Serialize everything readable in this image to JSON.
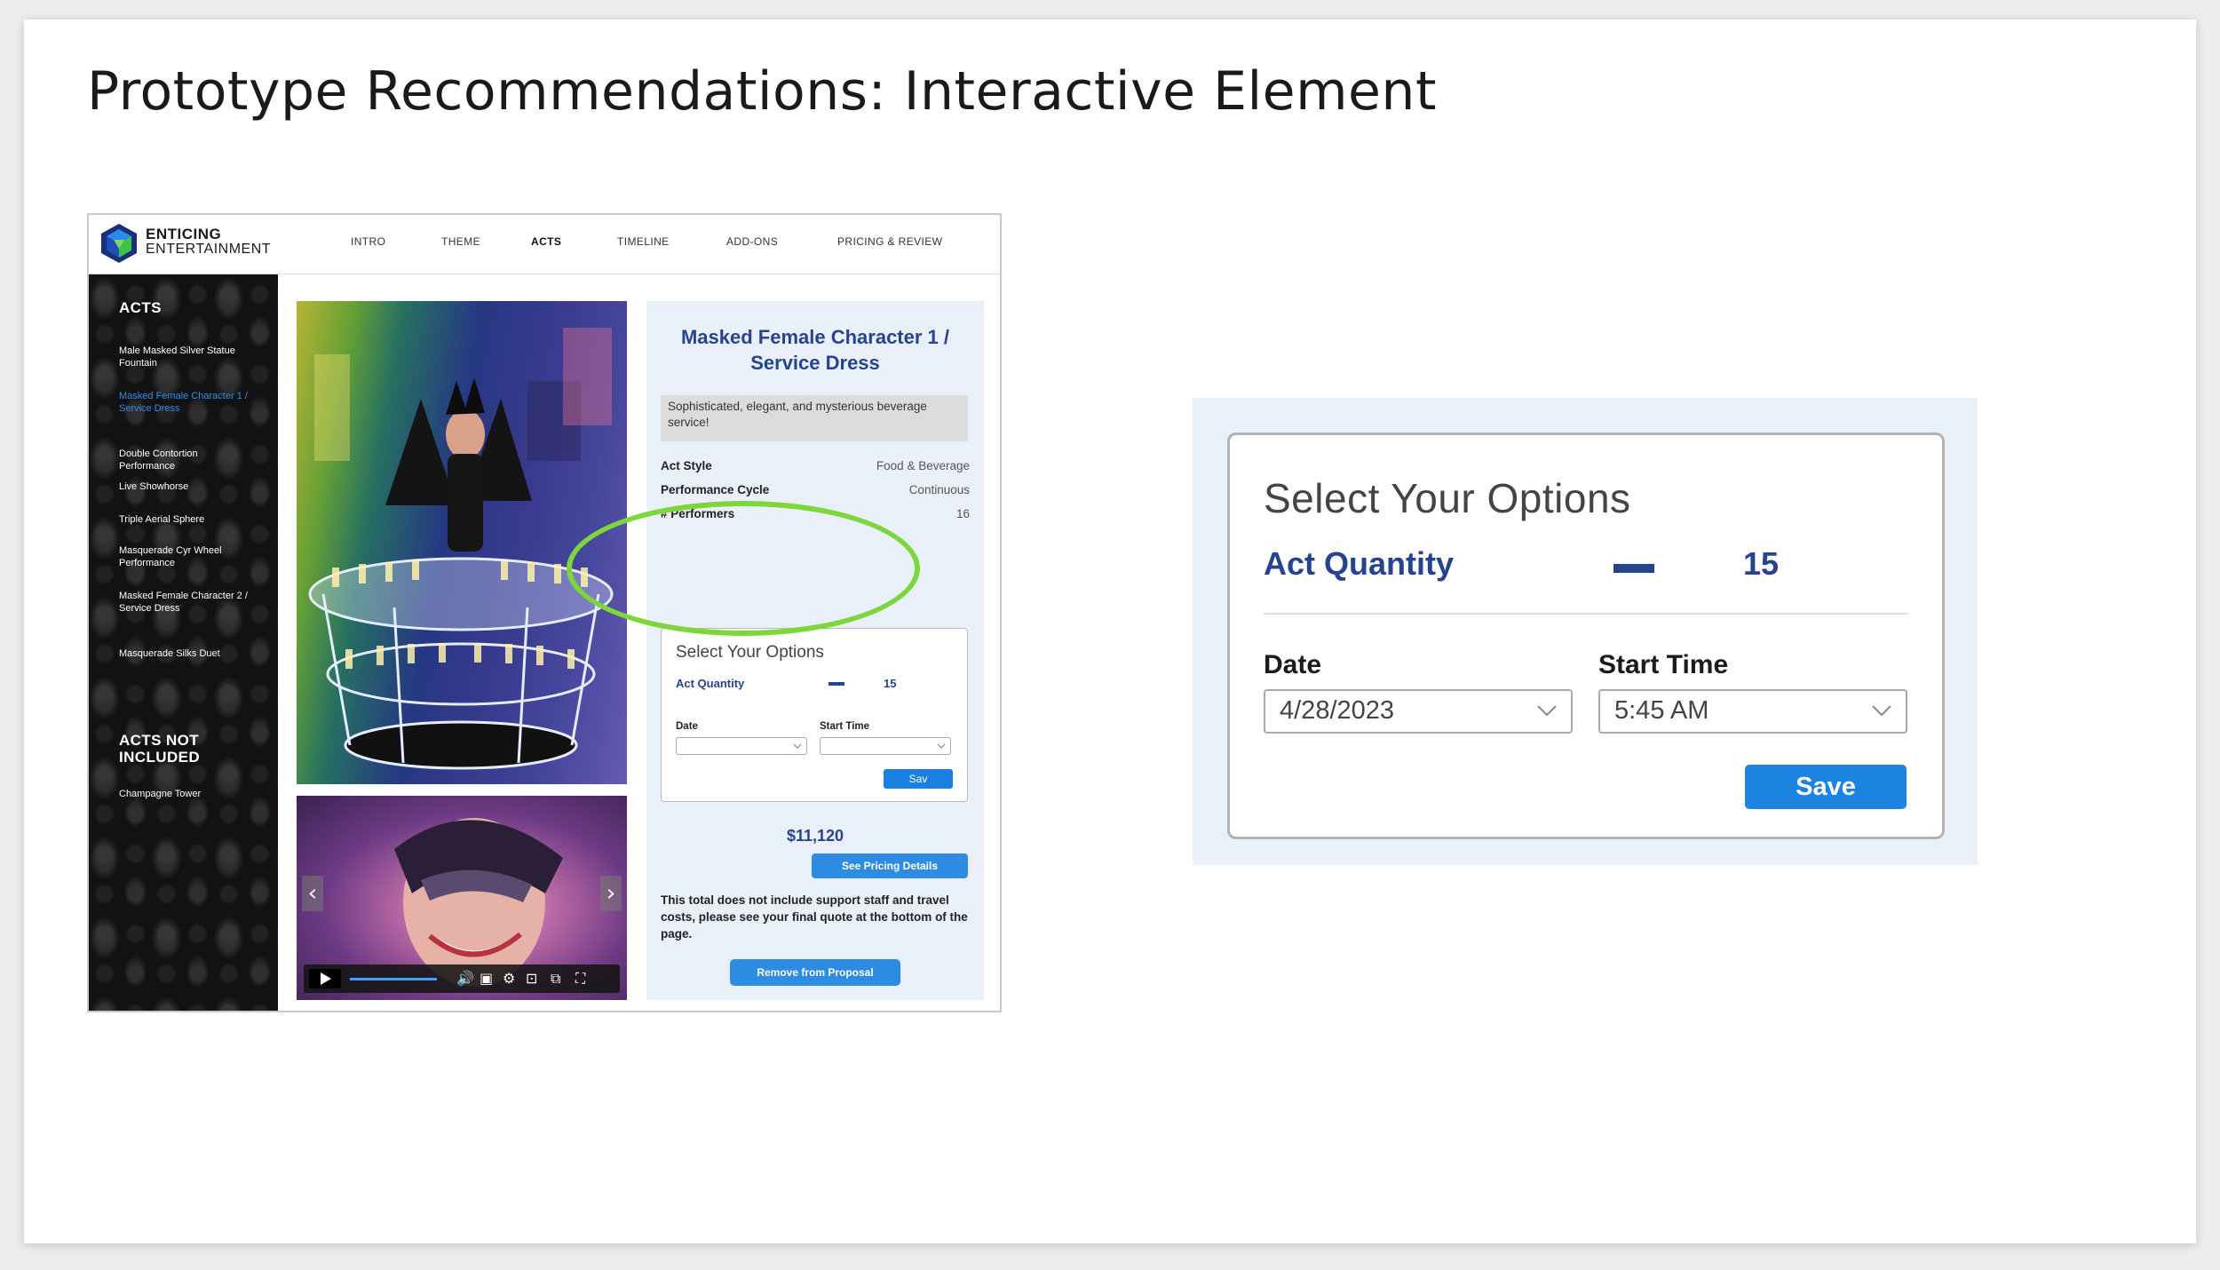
{
  "slide": {
    "title": "Prototype Recommendations: Interactive Element"
  },
  "site": {
    "brand_line1": "ENTICING",
    "brand_line2": "ENTERTAINMENT",
    "nav": [
      "INTRO",
      "THEME",
      "ACTS",
      "TIMELINE",
      "ADD-ONS",
      "PRICING & REVIEW"
    ],
    "active_nav": "ACTS"
  },
  "sidebar": {
    "acts_heading": "ACTS",
    "items": [
      "Male Masked Silver Statue Fountain",
      "Masked Female Character 1 / Service Dress",
      "Double Contortion Performance",
      "Live Showhorse",
      "Triple Aerial Sphere",
      "Masquerade Cyr Wheel Performance",
      "Masked Female Character 2 / Service Dress",
      "Masquerade Silks Duet"
    ],
    "active_item": "Masked Female Character 1 / Service Dress",
    "not_included_heading": "ACTS NOT INCLUDED",
    "not_included_items": [
      "Champagne Tower"
    ]
  },
  "act": {
    "title": "Masked Female Character 1 / Service Dress",
    "description": "Sophisticated, elegant, and mysterious beverage service!",
    "attributes": [
      {
        "label": "Act Style",
        "value": "Food & Beverage"
      },
      {
        "label": "Performance Cycle",
        "value": "Continuous"
      },
      {
        "label": "# Performers",
        "value": "16"
      }
    ],
    "price": "$11,120",
    "pricing_button": "See Pricing Details",
    "note": "This total does not include support staff and travel costs, please see your final quote at the bottom of the page.",
    "remove_button": "Remove from Proposal"
  },
  "mini_options": {
    "title": "Select Your Options",
    "qty_label": "Act Quantity",
    "qty_value": "15",
    "date_label": "Date",
    "time_label": "Start Time",
    "save_label": "Sav"
  },
  "options": {
    "title": "Select Your Options",
    "qty_label": "Act Quantity",
    "qty_value": "15",
    "date_label": "Date",
    "date_value": "4/28/2023",
    "time_label": "Start Time",
    "time_value": "5:45 AM",
    "save_label": "Save"
  },
  "video": {
    "icons": [
      "play-icon",
      "volume-icon",
      "captions-icon",
      "settings-icon",
      "cast-icon",
      "miniplayer-icon",
      "fullscreen-icon"
    ]
  },
  "colors": {
    "accent_blue": "#26438f",
    "button_blue": "#1b83e0",
    "highlight_green": "#7dd63a",
    "panel_bg": "#eaf0f9"
  }
}
